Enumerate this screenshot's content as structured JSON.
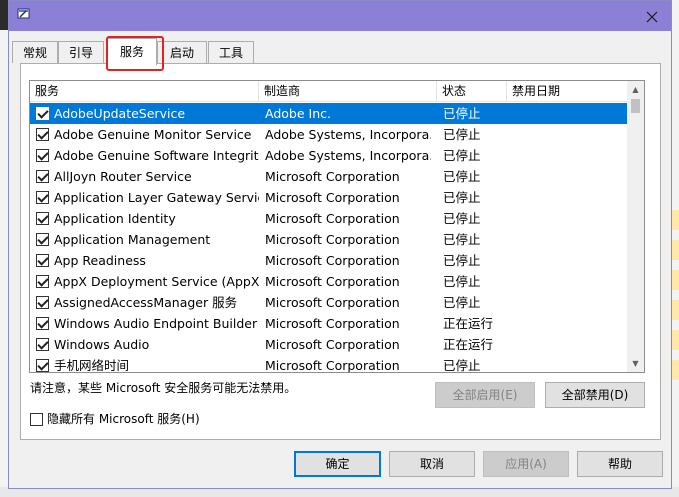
{
  "tabs": [
    {
      "label": "常规"
    },
    {
      "label": "引导"
    },
    {
      "label": "服务"
    },
    {
      "label": "启动"
    },
    {
      "label": "工具"
    }
  ],
  "table": {
    "headers": {
      "name": "服务",
      "maker": "制造商",
      "status": "状态",
      "date": "禁用日期"
    },
    "rows": [
      {
        "name": "AdobeUpdateService",
        "maker": "Adobe Inc.",
        "status": "已停止",
        "date": ""
      },
      {
        "name": "Adobe Genuine Monitor Service",
        "maker": "Adobe Systems, Incorpora...",
        "status": "已停止",
        "date": ""
      },
      {
        "name": "Adobe Genuine Software Integrit...",
        "maker": "Adobe Systems, Incorpora...",
        "status": "已停止",
        "date": ""
      },
      {
        "name": "AllJoyn Router Service",
        "maker": "Microsoft Corporation",
        "status": "已停止",
        "date": ""
      },
      {
        "name": "Application Layer Gateway Service",
        "maker": "Microsoft Corporation",
        "status": "已停止",
        "date": ""
      },
      {
        "name": "Application Identity",
        "maker": "Microsoft Corporation",
        "status": "已停止",
        "date": ""
      },
      {
        "name": "Application Management",
        "maker": "Microsoft Corporation",
        "status": "已停止",
        "date": ""
      },
      {
        "name": "App Readiness",
        "maker": "Microsoft Corporation",
        "status": "已停止",
        "date": ""
      },
      {
        "name": "AppX Deployment Service (AppX...",
        "maker": "Microsoft Corporation",
        "status": "已停止",
        "date": ""
      },
      {
        "name": "AssignedAccessManager 服务",
        "maker": "Microsoft Corporation",
        "status": "已停止",
        "date": ""
      },
      {
        "name": "Windows Audio Endpoint Builder",
        "maker": "Microsoft Corporation",
        "status": "正在运行",
        "date": ""
      },
      {
        "name": "Windows Audio",
        "maker": "Microsoft Corporation",
        "status": "正在运行",
        "date": ""
      },
      {
        "name": "手机网络时间",
        "maker": "Microsoft Corporation",
        "status": "已停止",
        "date": ""
      }
    ]
  },
  "notice": "请注意，某些 Microsoft 安全服务可能无法禁用。",
  "buttons": {
    "enable_all": "全部启用(E)",
    "disable_all": "全部禁用(D)",
    "ok": "确定",
    "cancel": "取消",
    "apply": "应用(A)",
    "help": "帮助"
  },
  "hide_ms_label": "隐藏所有 Microsoft 服务(H)",
  "colors": {
    "titlebar": "#8c7fd6",
    "selection": "#0078d7",
    "highlight": "#e02424"
  },
  "icons": {
    "title": "msconfig-icon",
    "close": "close-icon"
  }
}
